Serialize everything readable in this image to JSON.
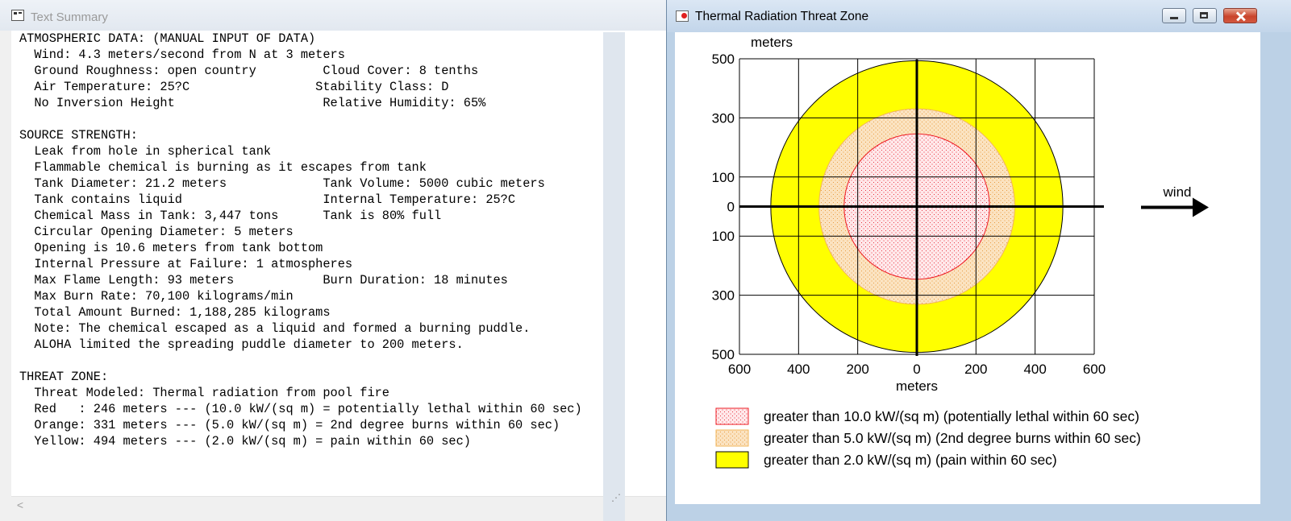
{
  "text_summary": {
    "title": "Text Summary",
    "lines": [
      "ATMOSPHERIC DATA: (MANUAL INPUT OF DATA)",
      "  Wind: 4.3 meters/second from N at 3 meters",
      "  Ground Roughness: open country         Cloud Cover: 8 tenths",
      "  Air Temperature: 25?C                 Stability Class: D",
      "  No Inversion Height                    Relative Humidity: 65%",
      "",
      "SOURCE STRENGTH:",
      "  Leak from hole in spherical tank",
      "  Flammable chemical is burning as it escapes from tank",
      "  Tank Diameter: 21.2 meters             Tank Volume: 5000 cubic meters",
      "  Tank contains liquid                   Internal Temperature: 25?C",
      "  Chemical Mass in Tank: 3,447 tons      Tank is 80% full",
      "  Circular Opening Diameter: 5 meters",
      "  Opening is 10.6 meters from tank bottom",
      "  Internal Pressure at Failure: 1 atmospheres",
      "  Max Flame Length: 93 meters            Burn Duration: 18 minutes",
      "  Max Burn Rate: 70,100 kilograms/min",
      "  Total Amount Burned: 1,188,285 kilograms",
      "  Note: The chemical escaped as a liquid and formed a burning puddle.",
      "  ALOHA limited the spreading puddle diameter to 200 meters.",
      "",
      "THREAT ZONE:",
      "  Threat Modeled: Thermal radiation from pool fire",
      "  Red   : 246 meters --- (10.0 kW/(sq m) = potentially lethal within 60 sec)",
      "  Orange: 331 meters --- (5.0 kW/(sq m) = 2nd degree burns within 60 sec)",
      "  Yellow: 494 meters --- (2.0 kW/(sq m) = pain within 60 sec)"
    ],
    "scroll_left_glyph": "<"
  },
  "threat_zone_window": {
    "title": "Thermal Radiation Threat Zone",
    "buttons": {
      "minimize": "minimize",
      "maximize": "maximize",
      "close": "close"
    },
    "resize_glyph": "⋰"
  },
  "chart_data": {
    "type": "threat-zone-plot",
    "ylabel": "meters",
    "xlabel": "meters",
    "x_ticks": [
      {
        "value": -600,
        "label": "600"
      },
      {
        "value": -400,
        "label": "400"
      },
      {
        "value": -200,
        "label": "200"
      },
      {
        "value": 0,
        "label": "0"
      },
      {
        "value": 200,
        "label": "200"
      },
      {
        "value": 400,
        "label": "400"
      },
      {
        "value": 600,
        "label": "600"
      }
    ],
    "y_ticks": [
      {
        "value": 500,
        "label": "500"
      },
      {
        "value": 300,
        "label": "300"
      },
      {
        "value": 100,
        "label": "100"
      },
      {
        "value": 0,
        "label": "0"
      },
      {
        "value": -100,
        "label": "100"
      },
      {
        "value": -300,
        "label": "300"
      },
      {
        "value": -500,
        "label": "500"
      }
    ],
    "xlim": [
      -600,
      600
    ],
    "ylim": [
      -500,
      500
    ],
    "grid_x": [
      -600,
      -400,
      -200,
      0,
      200,
      400,
      600
    ],
    "grid_y": [
      -500,
      -300,
      -100,
      100,
      300,
      500
    ],
    "wind_label": "wind",
    "wind_direction": "east",
    "zones": [
      {
        "name": "yellow",
        "radius": 494,
        "fill": "#ffff00",
        "stroke": "#000000",
        "pattern": "solid",
        "legend": "greater than 2.0 kW/(sq m) (pain within 60 sec)"
      },
      {
        "name": "orange",
        "radius": 331,
        "fill": "#fbe3c1",
        "stroke": "#f2b45a",
        "pattern": "dots",
        "dot_color": "#e89a3e",
        "legend": "greater than 5.0 kW/(sq m) (2nd degree burns within 60 sec)"
      },
      {
        "name": "red",
        "radius": 246,
        "fill": "#ffe8ea",
        "stroke": "#ee1c24",
        "pattern": "dots",
        "dot_color": "#e8323c",
        "legend": "greater than 10.0 kW/(sq m) (potentially lethal within 60 sec)"
      }
    ],
    "legend_order": [
      "red",
      "orange",
      "yellow"
    ]
  }
}
